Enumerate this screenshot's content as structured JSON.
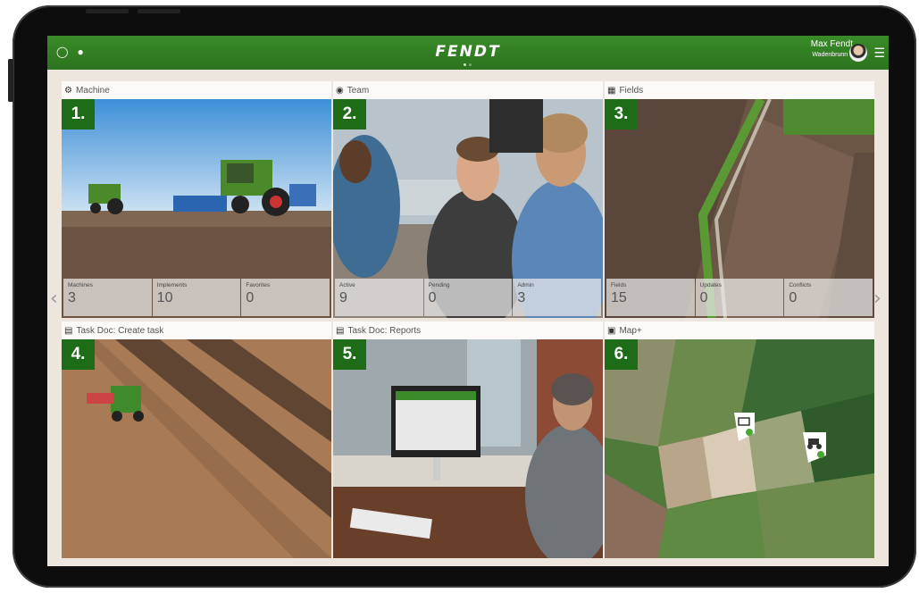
{
  "topbar": {
    "logo": "FENDT",
    "user_name": "Max Fendt",
    "user_farm": "Wadenbrunn 1",
    "icons": [
      "bell-icon",
      "user-icon",
      "menu-icon"
    ]
  },
  "tiles": [
    {
      "title": "Machine",
      "number": "1.",
      "icon": "tractor-icon",
      "stats": [
        {
          "label": "Machines",
          "value": "3"
        },
        {
          "label": "Implements",
          "value": "10"
        },
        {
          "label": "Favorites",
          "value": "0"
        }
      ]
    },
    {
      "title": "Team",
      "number": "2.",
      "icon": "team-icon",
      "stats": [
        {
          "label": "Active",
          "value": "9"
        },
        {
          "label": "Pending",
          "value": "0"
        },
        {
          "label": "Admin",
          "value": "3"
        }
      ]
    },
    {
      "title": "Fields",
      "number": "3.",
      "icon": "fields-icon",
      "stats": [
        {
          "label": "Fields",
          "value": "15"
        },
        {
          "label": "Updates",
          "value": "0"
        },
        {
          "label": "Conflicts",
          "value": "0"
        }
      ]
    },
    {
      "title": "Task Doc: Create task",
      "number": "4.",
      "icon": "document-icon"
    },
    {
      "title": "Task Doc: Reports",
      "number": "5.",
      "icon": "document-icon"
    },
    {
      "title": "Map+",
      "number": "6.",
      "icon": "map-icon"
    }
  ],
  "colors": {
    "brand_green": "#2f7d22",
    "number_badge": "#1e6b18"
  }
}
